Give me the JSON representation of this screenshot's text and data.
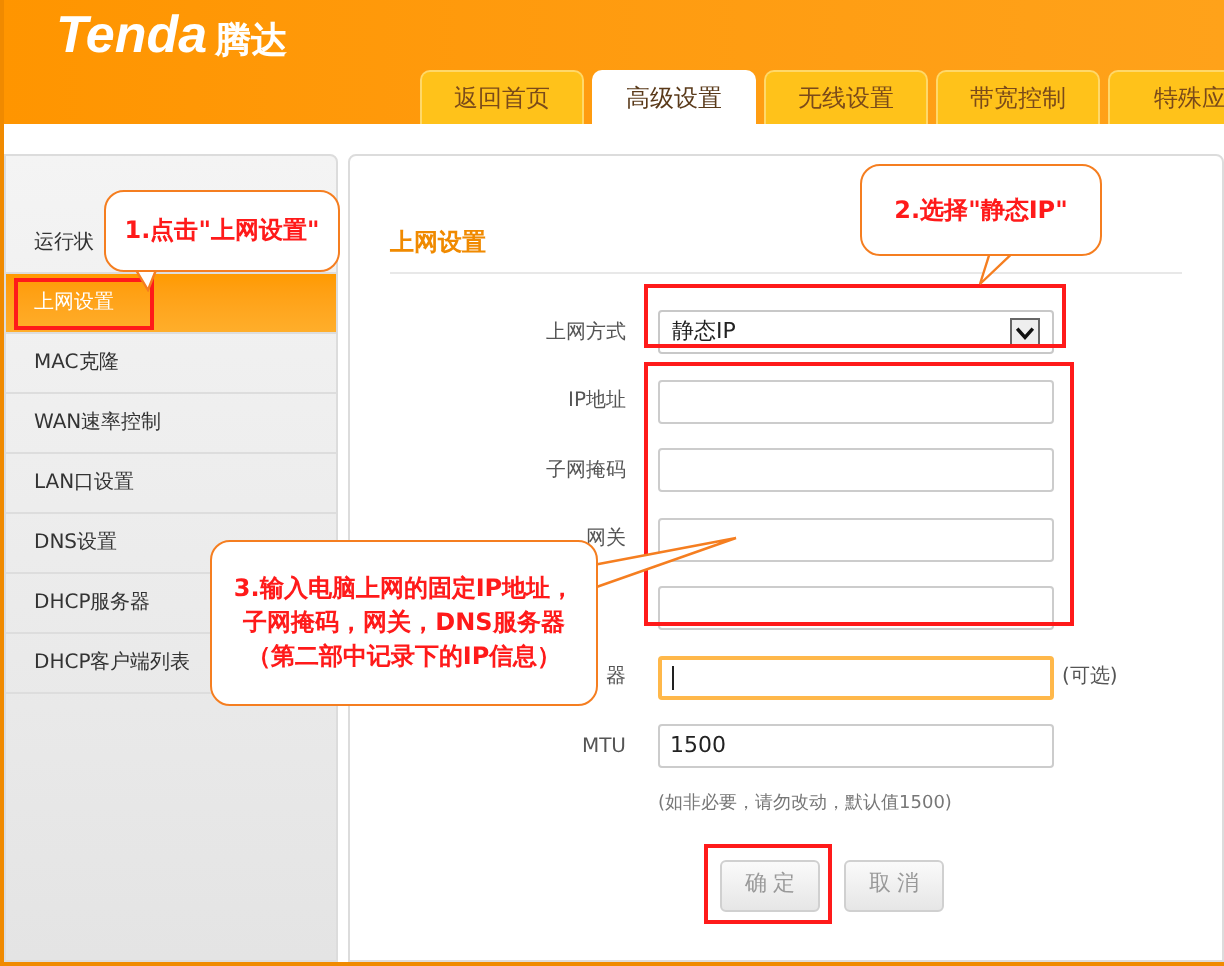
{
  "brand": {
    "logo": "Tenda",
    "name": "腾达"
  },
  "tabs": [
    {
      "label": "返回首页",
      "selected": false
    },
    {
      "label": "高级设置",
      "selected": true
    },
    {
      "label": "无线设置",
      "selected": false
    },
    {
      "label": "带宽控制",
      "selected": false
    },
    {
      "label": "特殊应",
      "selected": false
    }
  ],
  "sidebar": {
    "items": [
      {
        "label": "运行状",
        "selected": false
      },
      {
        "label": "上网设置",
        "selected": true
      },
      {
        "label": "MAC克隆",
        "selected": false
      },
      {
        "label": "WAN速率控制",
        "selected": false
      },
      {
        "label": "LAN口设置",
        "selected": false
      },
      {
        "label": "DNS设置",
        "selected": false
      },
      {
        "label": "DHCP服务器",
        "selected": false
      },
      {
        "label": "DHCP客户端列表",
        "selected": false
      }
    ]
  },
  "section_title": "上网设置",
  "form": [
    {
      "kind": "select",
      "label": "上网方式",
      "value": "静态IP"
    },
    {
      "kind": "text",
      "label": "IP地址",
      "focused": false
    },
    {
      "kind": "text",
      "label": "子网掩码",
      "focused": false
    },
    {
      "kind": "text",
      "label": "网关",
      "focused": false
    },
    {
      "kind": "text",
      "focused": false
    },
    {
      "kind": "text",
      "label": "器",
      "focused": true,
      "note": "(可选)"
    },
    {
      "kind": "text",
      "label": "MTU",
      "value": "1500",
      "focused": false
    }
  ],
  "hint": "(如非必要，请勿改动，默认值1500)",
  "buttons": [
    {
      "label": "确 定"
    },
    {
      "label": "取 消"
    }
  ],
  "annotations": [
    {
      "lines": [
        "1.点击\"上网设置\""
      ]
    },
    {
      "lines": [
        "2.选择\"静态IP\""
      ]
    },
    {
      "lines": [
        "3.输入电脑上网的固定IP地址，",
        "子网掩码，网关，DNS服务器",
        "（第二部中记录下的IP信息）"
      ]
    }
  ]
}
